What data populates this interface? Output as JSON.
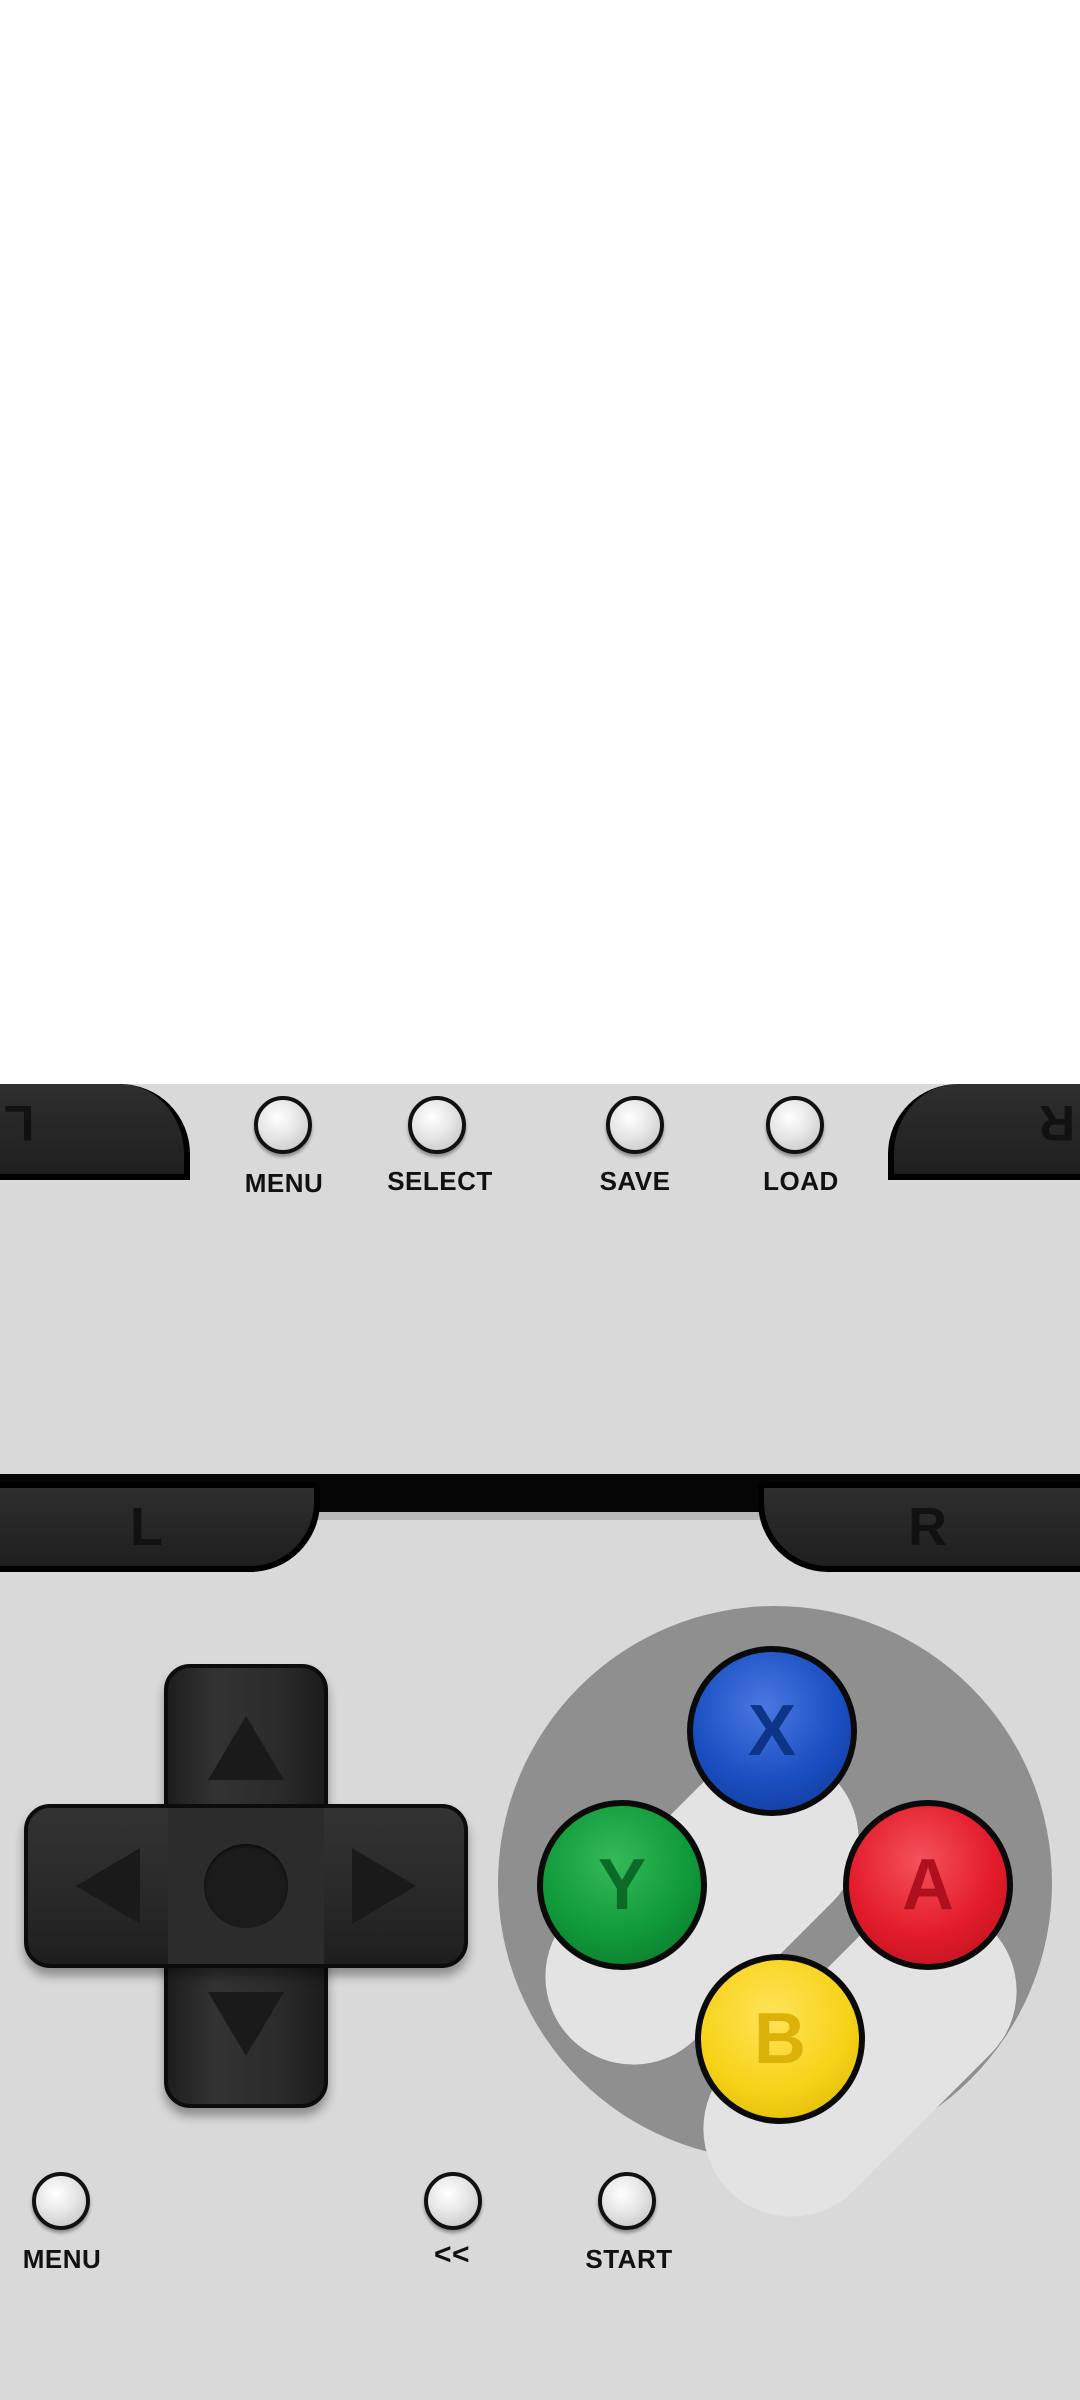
{
  "top_bar": {
    "menu_label": "MENU",
    "select_label": "SELECT",
    "save_label": "SAVE",
    "load_label": "LOAD",
    "left_shoulder_label": "L",
    "right_shoulder_label": "R"
  },
  "shoulders": {
    "left_label": "L",
    "right_label": "R"
  },
  "face_buttons": {
    "x": {
      "label": "X",
      "color": "#1a4fc2"
    },
    "y": {
      "label": "Y",
      "color": "#109a3a"
    },
    "a": {
      "label": "A",
      "color": "#e31b2a"
    },
    "b": {
      "label": "B",
      "color": "#f7d31a"
    }
  },
  "bottom_bar": {
    "menu_label": "MENU",
    "rewind_label": "<<",
    "start_label": "START"
  },
  "colors": {
    "pad_background": "#d9d9d9",
    "dpad": "#2a2a2a",
    "face_circle": "#8f8f8f"
  }
}
